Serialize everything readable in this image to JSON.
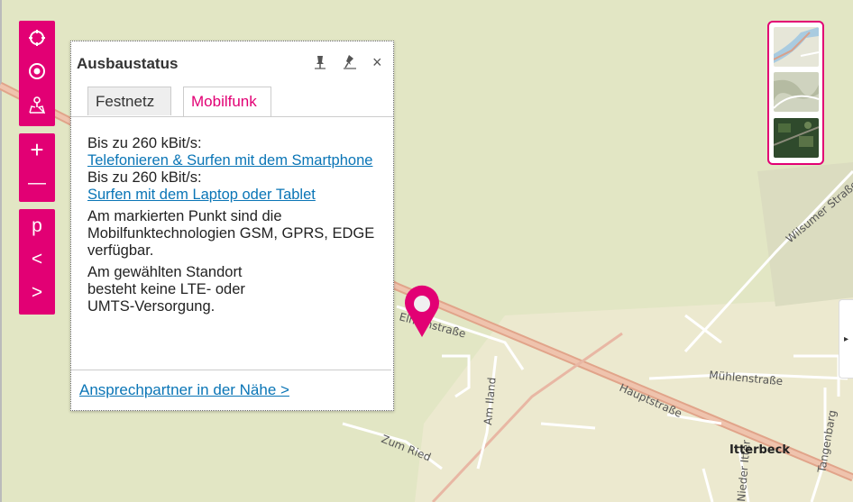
{
  "map": {
    "streets": [
      "Wilsumer Straße",
      "Elmenstraße",
      "Am Iland",
      "Mühlenstraße",
      "Hauptstraße",
      "Zum Ried",
      "Tangenbarg",
      "Nieder Itter"
    ],
    "town": "Itterbeck"
  },
  "controls": {
    "locate_icon": "crosshair-icon",
    "target_icon": "target-icon",
    "map_icon": "map-person-icon",
    "zoom_in": "+",
    "zoom_out": "—",
    "p_label": "p",
    "prev_label": "<",
    "next_label": ">"
  },
  "layers": [
    "street-map",
    "terrain-map",
    "satellite-map"
  ],
  "popup": {
    "title": "Ausbaustatus",
    "tabs": [
      "Festnetz",
      "Mobilfunk"
    ],
    "active_tab": "Mobilfunk",
    "speed1_label": "Bis zu 260 kBit/s:",
    "speed1_link": "Telefonieren & Surfen mit dem Smartphone",
    "speed2_label": "Bis zu 260 kBit/s:",
    "speed2_link": "Surfen mit dem Laptop oder Tablet",
    "tech_text": "Am markierten Punkt sind die Mobilfunktechnologien GSM, GPRS, EDGE verfügbar.",
    "lte_text": "Am gewählten Standort besteht keine LTE- oder UMTS-Versorgung.",
    "footer_link": "Ansprechpartner in der Nähe >",
    "close": "×"
  },
  "side_toggle": "▸",
  "colors": {
    "accent": "#e20074",
    "link": "#0a75b6",
    "map_bg": "#e2e6c4",
    "road": "#e1a48a"
  }
}
